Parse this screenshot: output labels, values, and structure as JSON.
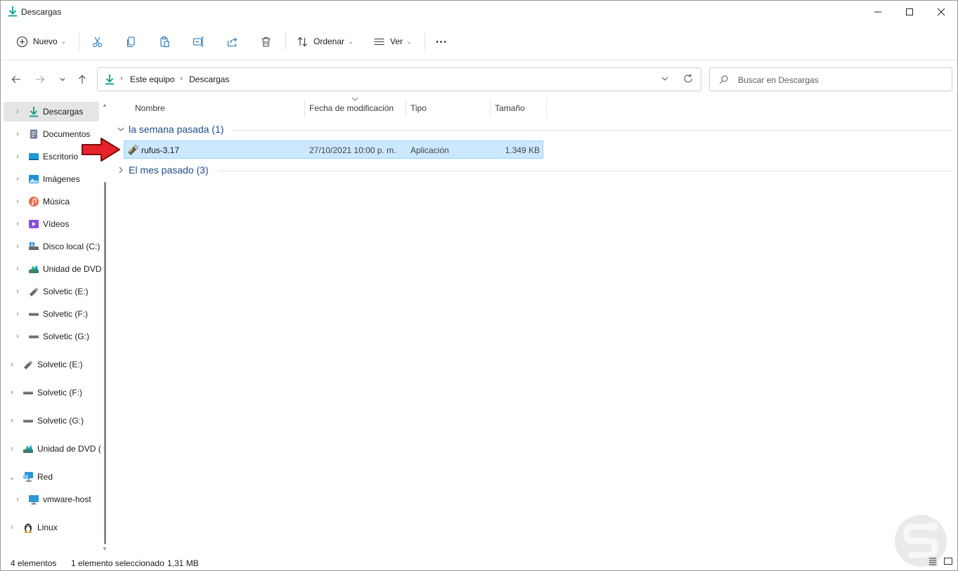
{
  "window": {
    "title": "Descargas",
    "accent_color": "#00a08a",
    "controls": [
      "minimize-icon",
      "maximize-icon",
      "close-icon"
    ]
  },
  "toolbar": {
    "new_label": "Nuevo",
    "sort_label": "Ordenar",
    "view_label": "Ver",
    "icons": [
      "cut-icon",
      "copy-icon",
      "paste-icon",
      "rename-icon",
      "share-icon",
      "delete-icon",
      "more-icon"
    ]
  },
  "address": {
    "crumbs": [
      "Este equipo",
      "Descargas"
    ]
  },
  "search": {
    "placeholder": "Buscar en Descargas"
  },
  "sidebar": {
    "items": [
      {
        "label": "Descargas",
        "icon": "download-icon",
        "selected": true
      },
      {
        "label": "Documentos",
        "icon": "documents-icon"
      },
      {
        "label": "Escritorio",
        "icon": "desktop-icon"
      },
      {
        "label": "Imágenes",
        "icon": "pictures-icon"
      },
      {
        "label": "Música",
        "icon": "music-icon"
      },
      {
        "label": "Vídeos",
        "icon": "videos-icon"
      },
      {
        "label": "Disco local (C:)",
        "icon": "local-disk-icon"
      },
      {
        "label": "Unidad de DVD",
        "icon": "dvd-drive-icon"
      },
      {
        "label": "Solvetic (E:)",
        "icon": "usb-drive-icon"
      },
      {
        "label": "Solvetic (F:)",
        "icon": "drive-icon"
      },
      {
        "label": "Solvetic (G:)",
        "icon": "drive-icon"
      },
      {
        "label": "Solvetic (E:)",
        "icon": "usb-drive-icon"
      },
      {
        "label": "Solvetic (F:)",
        "icon": "drive-icon"
      },
      {
        "label": "Solvetic (G:)",
        "icon": "drive-icon"
      },
      {
        "label": "Unidad de DVD (",
        "icon": "dvd-drive-icon"
      },
      {
        "label": "Red",
        "icon": "network-icon",
        "expanded": true
      },
      {
        "label": "vmware-host",
        "icon": "monitor-icon"
      },
      {
        "label": "Linux",
        "icon": "linux-icon"
      }
    ]
  },
  "columns": {
    "name": "Nombre",
    "modified": "Fecha de modificación",
    "type": "Tipo",
    "size": "Tamaño"
  },
  "groups": [
    {
      "label": "la semana pasada (1)",
      "expanded": true,
      "files": [
        {
          "name": "rufus-3.17",
          "modified": "27/10/2021 10:00 p. m.",
          "type": "Aplicación",
          "size": "1.349 KB",
          "selected": true
        }
      ]
    },
    {
      "label": "El mes pasado (3)",
      "expanded": false
    }
  ],
  "status": {
    "count": "4 elementos",
    "selection": "1 elemento seleccionado",
    "selection_size": "1,31 MB"
  }
}
